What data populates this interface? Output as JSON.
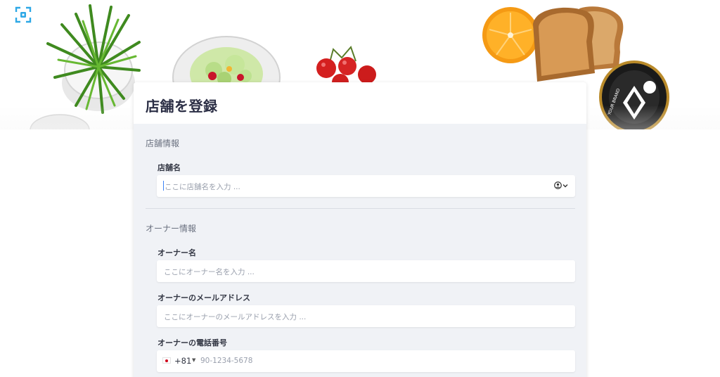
{
  "form": {
    "title": "店舗を登録",
    "store_section": "店舗情報",
    "store_name_label": "店舗名",
    "store_name_placeholder": "ここに店舗名を入力 ...",
    "owner_section": "オーナー情報",
    "owner_name_label": "オーナー名",
    "owner_name_placeholder": "ここにオーナー名を入力 ...",
    "owner_email_label": "オーナーのメールアドレス",
    "owner_email_placeholder": "ここにオーナーのメールアドレスを入力 ...",
    "owner_phone_label": "オーナーの電話番号",
    "phone_country_code": "+81",
    "phone_placeholder": "90-1234-5678"
  },
  "decor": {
    "jar_brand": "YOUR BRAND"
  },
  "icons": {
    "logo": "scan-frame-icon",
    "account": "account-circle-icon",
    "dropdown": "chevron-down-icon",
    "flag": "japan-flag-icon"
  },
  "colors": {
    "accent": "#3b82f6",
    "logo": "#2ea8e6",
    "card_bg": "#f0f2f6",
    "title": "#2b2e45"
  }
}
